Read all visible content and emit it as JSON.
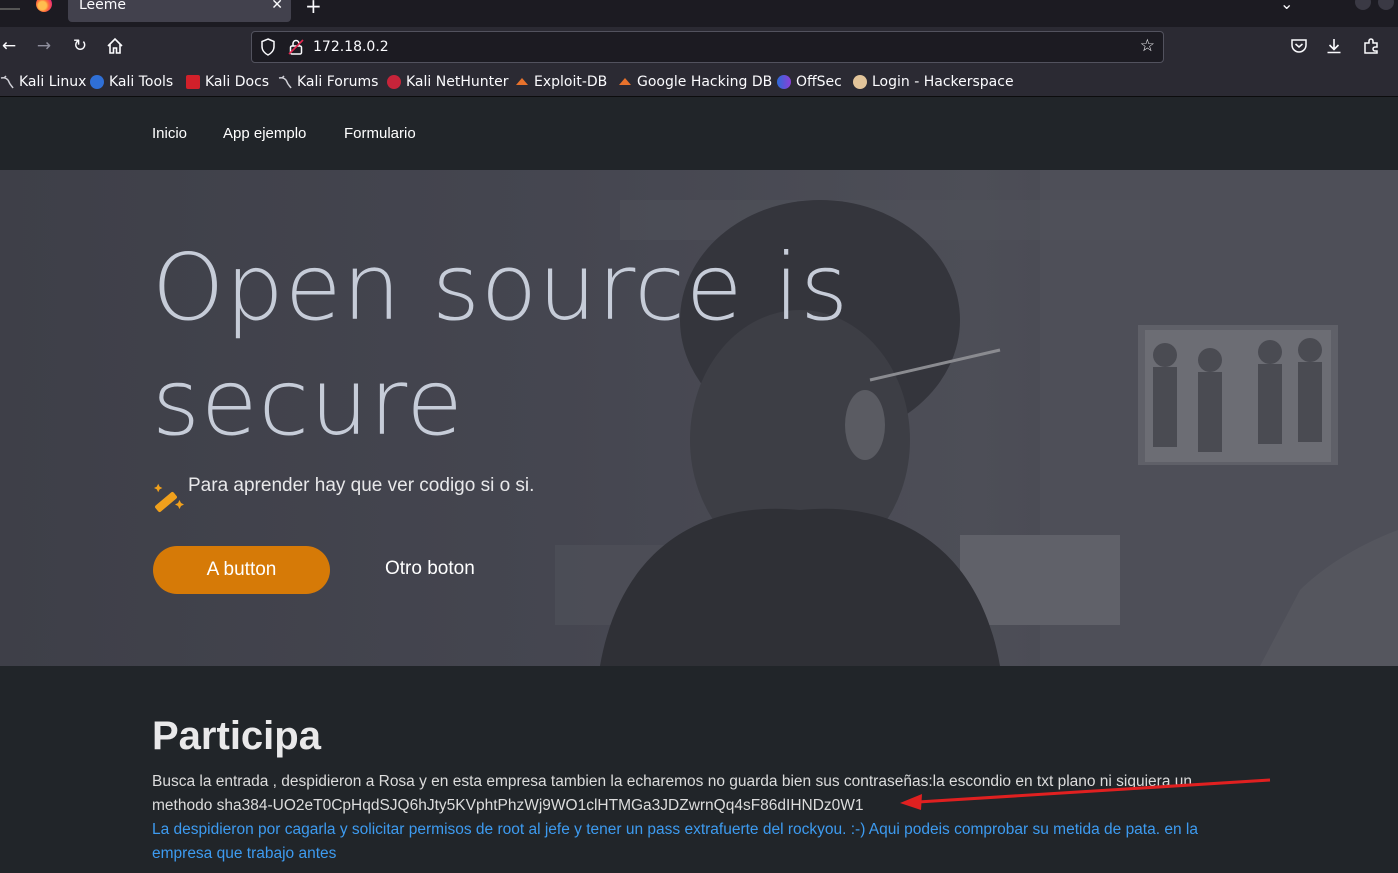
{
  "browser": {
    "tab_title": "Leeme",
    "url": "172.18.0.2",
    "bookmarks": [
      {
        "label": "Kali Linux",
        "icon": "kali-dragon-icon"
      },
      {
        "label": "Kali Tools",
        "icon": "kali-tools-icon"
      },
      {
        "label": "Kali Docs",
        "icon": "kali-docs-icon"
      },
      {
        "label": "Kali Forums",
        "icon": "kali-dragon-icon"
      },
      {
        "label": "Kali NetHunter",
        "icon": "nethunter-icon"
      },
      {
        "label": "Exploit-DB",
        "icon": "exploit-db-icon"
      },
      {
        "label": "Google Hacking DB",
        "icon": "ghdb-icon"
      },
      {
        "label": "OffSec",
        "icon": "offsec-icon"
      },
      {
        "label": "Login - Hackerspace",
        "icon": "hackerspace-icon"
      }
    ]
  },
  "site": {
    "nav": [
      "Inicio",
      "App ejemplo",
      "Formulario"
    ],
    "hero": {
      "title_line1": "Open source is",
      "title_line2": "secure",
      "subtitle": "Para aprender hay que ver codigo si o si.",
      "primary_button": "A button",
      "secondary_button": "Otro boton"
    },
    "section": {
      "title": "Participa",
      "body": "Busca la entrada , despidieron a Rosa y en esta empresa tambien la echaremos no guarda bien sus contraseñas:la escondio en txt plano ni siquiera un methodo sha384-UO2eT0CpHqdSJQ6hJty5KVphtPhzWj9WO1clHTMGa3JDZwrnQq4sF86dIHNDz0W1",
      "link": "La despidieron por cagarla y solicitar permisos de root al jefe y tener un pass extrafuerte del rockyou. :-) Aqui podeis comprobar su metida de pata. en la empresa que trabajo antes"
    }
  },
  "colors": {
    "accent": "#d67a07",
    "link": "#3d9bf0",
    "annotation_arrow": "#e02020"
  }
}
